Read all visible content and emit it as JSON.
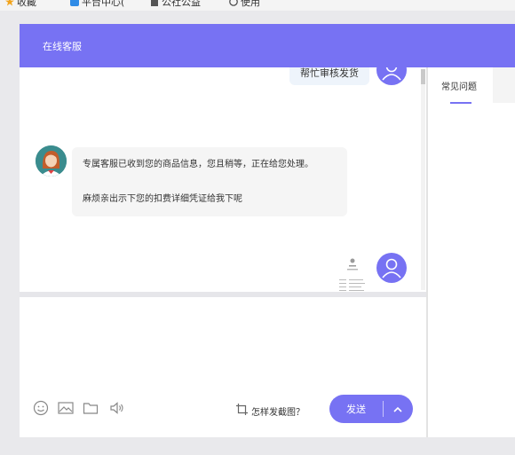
{
  "browser": {
    "bookmarks": [
      {
        "label": "收藏",
        "icon": "star-icon"
      },
      {
        "label": "平台中心(",
        "icon": "app-icon"
      },
      {
        "label": "公社公益",
        "icon": "doc-icon"
      },
      {
        "label": "使用",
        "icon": "globe-icon"
      }
    ]
  },
  "header": {
    "title": "在线客服"
  },
  "chat": {
    "messages": {
      "self_text": "帮忙审核发货",
      "agent_line1": "专属客服已收到您的商品信息，您且稍等，正在给您处理。",
      "agent_line2": "麻烦亲出示下您的扣费详细凭证给我下呢"
    }
  },
  "composer": {
    "crop_hint": "怎样发截图？",
    "send_label": "发送"
  },
  "sidebar": {
    "tabs": [
      {
        "label": "常见问题",
        "active": true
      }
    ]
  },
  "colors": {
    "accent": "#7772f3"
  }
}
